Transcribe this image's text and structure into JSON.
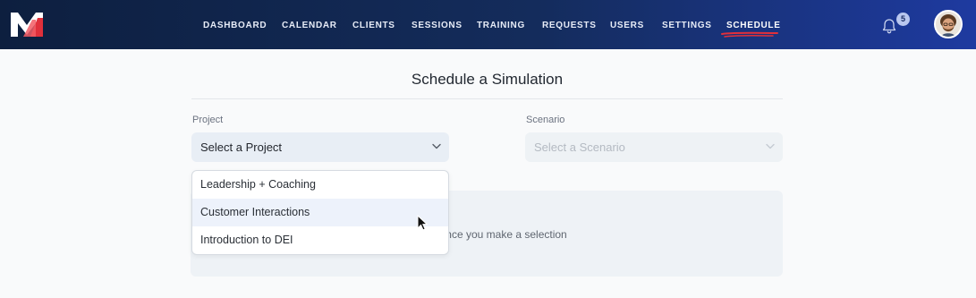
{
  "header": {
    "logo_text": "M",
    "nav": [
      {
        "label": "DASHBOARD",
        "active": false
      },
      {
        "label": "CALENDAR",
        "active": false
      },
      {
        "label": "CLIENTS",
        "active": false
      },
      {
        "label": "SESSIONS",
        "active": false
      },
      {
        "label": "TRAINING",
        "active": false
      },
      {
        "label": "REQUESTS",
        "active": false
      },
      {
        "label": "USERS",
        "active": false
      },
      {
        "label": "SETTINGS",
        "active": false
      },
      {
        "label": "SCHEDULE",
        "active": true
      }
    ],
    "notification_count": "5",
    "icons": {
      "notifications": "bell-icon",
      "profile": "avatar"
    },
    "active_accent": "#e0303b"
  },
  "page": {
    "title": "Schedule a Simulation"
  },
  "form": {
    "project": {
      "label": "Project",
      "placeholder": "Select a Project",
      "options": [
        {
          "label": "Leadership + Coaching",
          "hovered": false
        },
        {
          "label": "Customer Interactions",
          "hovered": true
        },
        {
          "label": "Introduction to DEI",
          "hovered": false
        }
      ]
    },
    "scenario": {
      "label": "Scenario",
      "placeholder": "Select a Scenario",
      "disabled": true
    },
    "panel_message": "ill load once you make a selection"
  }
}
